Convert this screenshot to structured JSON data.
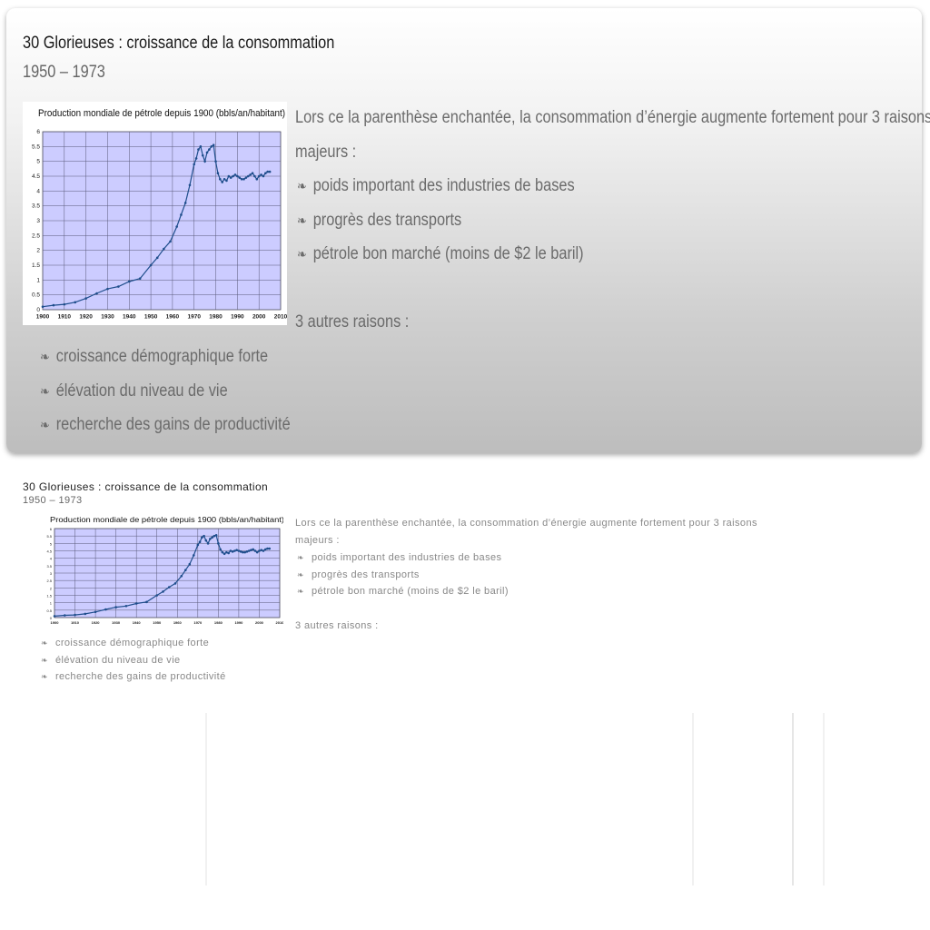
{
  "slide": {
    "title": "30 Glorieuses : croissance de la consommation",
    "subtitle": "1950 – 1973",
    "intro_line1": "Lors ce la parenthèse enchantée, la consommation d’énergie augmente fortement pour 3 raisons",
    "intro_line2": "majeurs :",
    "reasons": [
      "poids important des industries de bases",
      "progrès des transports",
      "pétrole bon marché (moins de $2 le baril)"
    ],
    "other_heading": "3 autres raisons :",
    "other_reasons": [
      "croissance démographique forte",
      "élévation du niveau de vie",
      "recherche des gains de productivité"
    ],
    "bullet_glyph": "❧"
  },
  "chart_data": {
    "type": "line",
    "title": "Production mondiale de pétrole depuis 1900 (bbls/an/habitant)",
    "xlabel": "",
    "ylabel": "",
    "xlim": [
      1900,
      2010
    ],
    "ylim": [
      0,
      6
    ],
    "x_ticks": [
      "1900",
      "1910",
      "1920",
      "1930",
      "1940",
      "1950",
      "1960",
      "1970",
      "1980",
      "1990",
      "2000",
      "2010"
    ],
    "y_ticks": [
      "0",
      "0.5",
      "1",
      "1.5",
      "2",
      "2.5",
      "3",
      "3.5",
      "4",
      "4.5",
      "5",
      "5.5",
      "6"
    ],
    "grid": true,
    "plot_background": "#ccccff",
    "line_color": "#1f4e8c",
    "series": [
      {
        "x": [
          1900,
          1905,
          1910,
          1915,
          1920,
          1925,
          1930,
          1935,
          1940,
          1945,
          1950,
          1953,
          1956,
          1959,
          1962,
          1964,
          1966,
          1968,
          1970,
          1971,
          1972,
          1973,
          1974,
          1975,
          1976,
          1977,
          1978,
          1979,
          1980,
          1981,
          1982,
          1983,
          1984,
          1985,
          1986,
          1987,
          1988,
          1989,
          1990,
          1991,
          1992,
          1993,
          1994,
          1995,
          1996,
          1997,
          1998,
          1999,
          2000,
          2001,
          2002,
          2003,
          2004,
          2005
        ],
        "y": [
          0.1,
          0.15,
          0.18,
          0.25,
          0.38,
          0.55,
          0.7,
          0.78,
          0.95,
          1.05,
          1.5,
          1.75,
          2.05,
          2.3,
          2.8,
          3.2,
          3.6,
          4.2,
          4.9,
          5.1,
          5.4,
          5.5,
          5.2,
          5.0,
          5.3,
          5.4,
          5.5,
          5.55,
          5.0,
          4.6,
          4.4,
          4.3,
          4.4,
          4.35,
          4.5,
          4.45,
          4.5,
          4.55,
          4.5,
          4.45,
          4.4,
          4.4,
          4.45,
          4.5,
          4.55,
          4.6,
          4.5,
          4.4,
          4.5,
          4.55,
          4.5,
          4.6,
          4.65,
          4.65
        ]
      }
    ]
  }
}
